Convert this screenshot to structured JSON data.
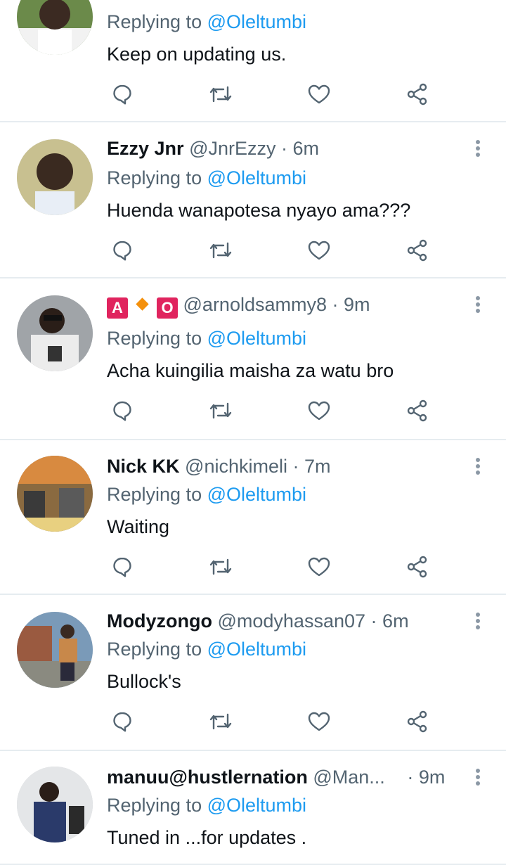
{
  "reply_prefix": "Replying to",
  "reply_target": "@Oleltumbi",
  "tweets": [
    {
      "name": "",
      "handle": "",
      "time": "",
      "text": "Keep on updating us."
    },
    {
      "name": "Ezzy Jnr",
      "handle": "@JnrEzzy",
      "sep": "·",
      "time": "6m",
      "text": "Huenda wanapotesa nyayo ama???"
    },
    {
      "name": "",
      "badge1": "A",
      "badge2": "O",
      "handle": "@arnoldsammy8",
      "sep": "·",
      "time": "9m",
      "text": "Acha kuingilia maisha za watu bro"
    },
    {
      "name": "Nick KK",
      "handle": "@nichkimeli",
      "sep": "·",
      "time": "7m",
      "text": "Waiting"
    },
    {
      "name": "Modyzongo",
      "handle": "@modyhassan07",
      "sep": "·",
      "time": "6m",
      "text": "Bullock's"
    },
    {
      "name": "manuu@hustlernation",
      "handle": "@Man...",
      "sep": "·",
      "time": "9m",
      "text": "Tuned in ...for updates ."
    }
  ],
  "icons": [
    "reply-icon",
    "retweet-icon",
    "like-icon",
    "share-icon",
    "more-options-icon"
  ],
  "colors": {
    "mention": "#1d9bf0",
    "secondary_text": "#536471",
    "divider": "#e6ecf0",
    "badge": "#e0245e",
    "diamond": "#f4900c"
  }
}
